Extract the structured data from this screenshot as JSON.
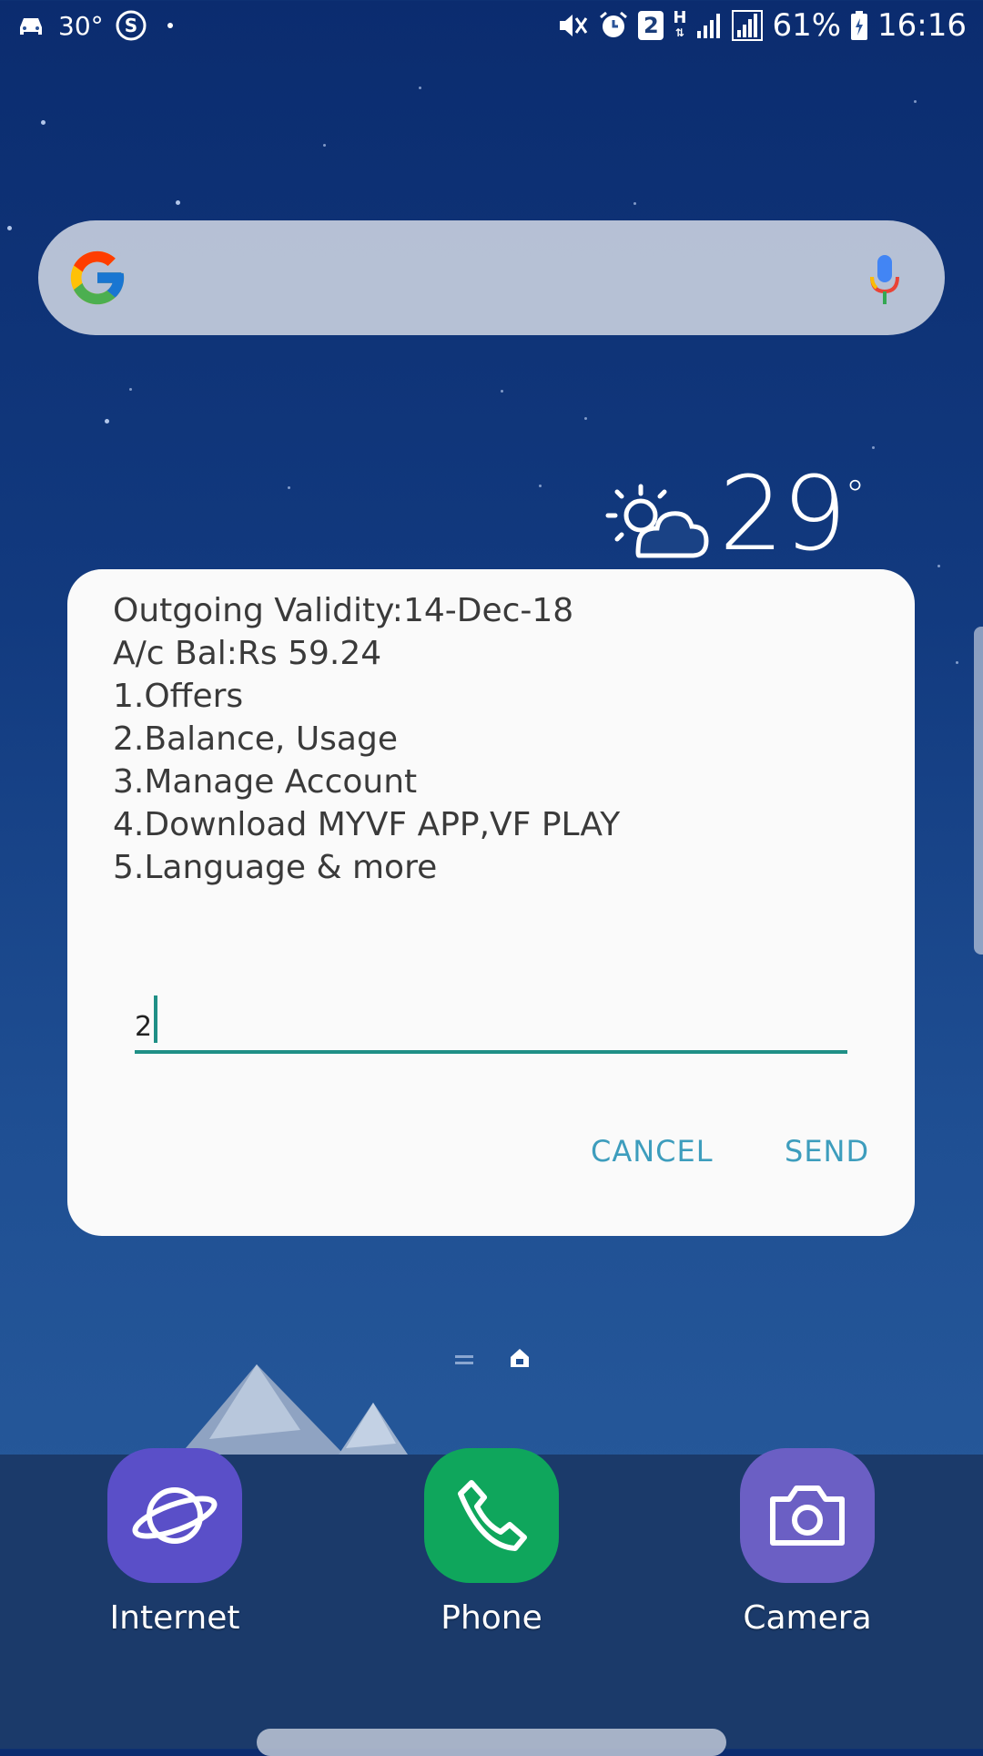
{
  "status_bar": {
    "temperature": "30°",
    "notification_badge": "2",
    "network_type": "H",
    "battery": "61%",
    "time": "16:16",
    "left_icons": [
      "car-icon",
      "skype-icon",
      "dot-icon"
    ],
    "right_icons": [
      "mute-icon",
      "alarm-icon",
      "sim-2-icon",
      "data-h-icon",
      "signal-icon",
      "roaming-signal-icon",
      "battery-icon"
    ]
  },
  "search_widget": {
    "logo_icon": "google-g-icon",
    "voice_icon": "microphone-icon"
  },
  "weather": {
    "icon": "partly-cloudy-icon",
    "temperature": "29",
    "degree": "°"
  },
  "dialog": {
    "lines": [
      "Outgoing Validity:14-Dec-18",
      "A/c Bal:Rs 59.24",
      "1.Offers",
      "2.Balance, Usage",
      "3.Manage Account",
      "4.Download MYVF APP,VF PLAY",
      "5.Language & more"
    ],
    "input_value": "2",
    "cancel_label": "CANCEL",
    "send_label": "SEND",
    "accent_color": "#1f8f86",
    "button_color": "#3d9dbd"
  },
  "page_indicator": {
    "icons": [
      "menu-lines-icon",
      "home-indicator-icon"
    ]
  },
  "dock": {
    "apps": [
      {
        "label": "Internet",
        "icon": "internet-planet-icon",
        "color": "#5a4fc8"
      },
      {
        "label": "Phone",
        "icon": "phone-handset-icon",
        "color": "#0fa65c"
      },
      {
        "label": "Camera",
        "icon": "camera-icon",
        "color": "#6b5fc4"
      }
    ]
  }
}
